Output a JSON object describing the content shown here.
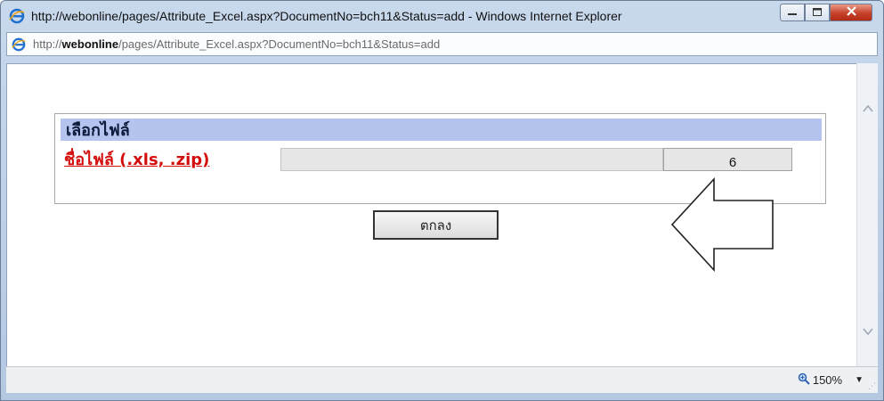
{
  "window": {
    "title": "http://webonline/pages/Attribute_Excel.aspx?DocumentNo=bch11&Status=add - Windows Internet Explorer",
    "minimize_icon": "minimize-icon",
    "maximize_icon": "maximize-icon",
    "close_icon": "close-icon"
  },
  "addressbar": {
    "prefix": "http://",
    "host": "webonline",
    "path": "/pages/Attribute_Excel.aspx?DocumentNo=bch11&Status=add"
  },
  "panel": {
    "title": "เลือกไฟล์",
    "file_label": "ชื่อไฟล์ (.xls, .zip)",
    "file_value": ""
  },
  "buttons": {
    "ok_label": "ตกลง"
  },
  "callout": {
    "number": "6"
  },
  "statusbar": {
    "zoom": "150%"
  },
  "colors": {
    "panel_header_bg": "#b4c4ef",
    "label_red": "#d40d0d",
    "close_red": "#c5412a"
  }
}
